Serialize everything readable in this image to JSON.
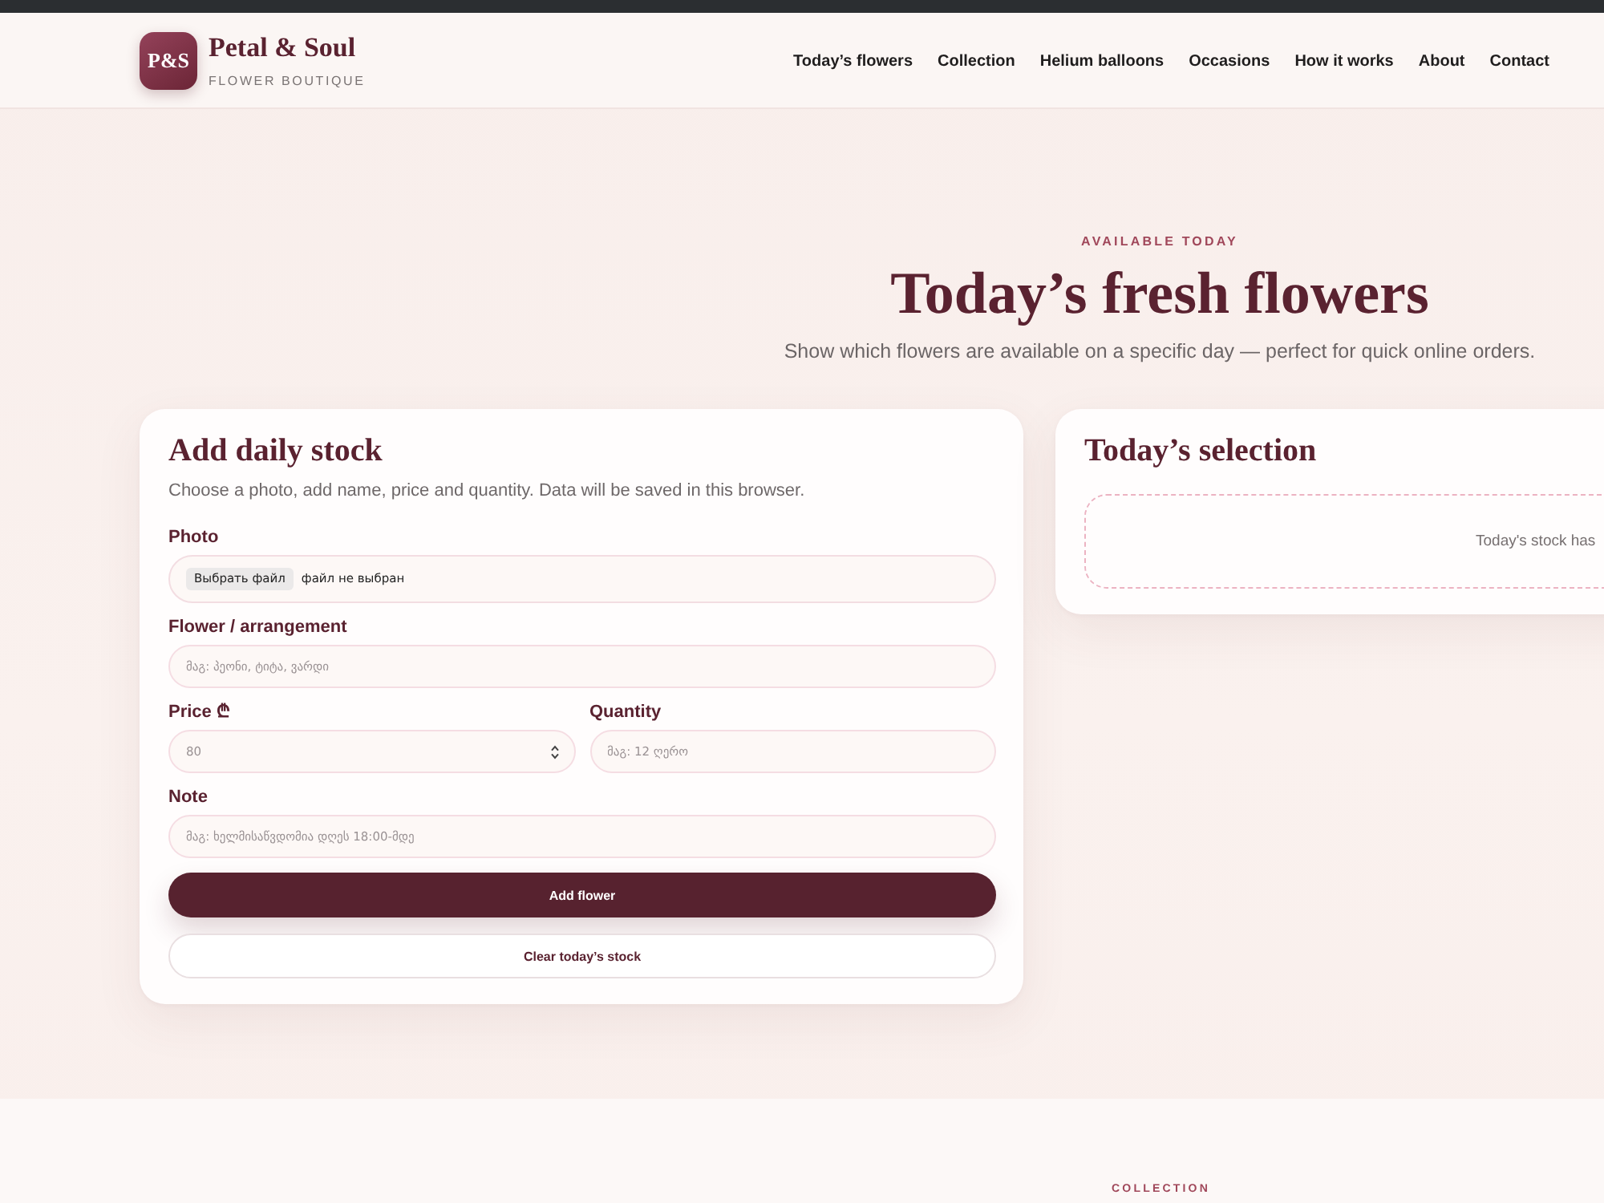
{
  "header": {
    "logo_mark": "P&S",
    "brand": "Petal & Soul",
    "tagline": "FLOWER BOUTIQUE",
    "nav": [
      "Today’s flowers",
      "Collection",
      "Helium balloons",
      "Occasions",
      "How it works",
      "About",
      "Contact"
    ]
  },
  "hero": {
    "eyebrow": "AVAILABLE TODAY",
    "title": "Today’s fresh flowers",
    "subtitle": "Show which flowers are available on a specific day — perfect for quick online orders."
  },
  "stock_form": {
    "title": "Add daily stock",
    "description": "Choose a photo, add name, price and quantity. Data will be saved in this browser.",
    "rows": [
      {
        "fields": [
          {
            "kind": "file",
            "label": "Photo",
            "button": "Выбрать файл",
            "status": "файл не выбран"
          }
        ]
      },
      {
        "fields": [
          {
            "kind": "text",
            "label": "Flower / arrangement",
            "placeholder": "მაგ: პეონი, ტიტა, ვარდი"
          }
        ]
      },
      {
        "fields": [
          {
            "kind": "number",
            "label": "Price ₾",
            "placeholder": "80"
          },
          {
            "kind": "text",
            "label": "Quantity",
            "placeholder": "მაგ: 12 ღერო"
          }
        ]
      },
      {
        "fields": [
          {
            "kind": "text",
            "label": "Note",
            "placeholder": "მაგ: ხელმისაწვდომია დღეს 18:00-მდე"
          }
        ]
      }
    ],
    "buttons": [
      {
        "kind": "primary",
        "label": "Add flower"
      },
      {
        "kind": "secondary",
        "label": "Clear today’s stock"
      }
    ]
  },
  "selection": {
    "title": "Today’s selection",
    "empty_message": "Today's stock has"
  },
  "next_section": {
    "eyebrow": "COLLECTION"
  }
}
